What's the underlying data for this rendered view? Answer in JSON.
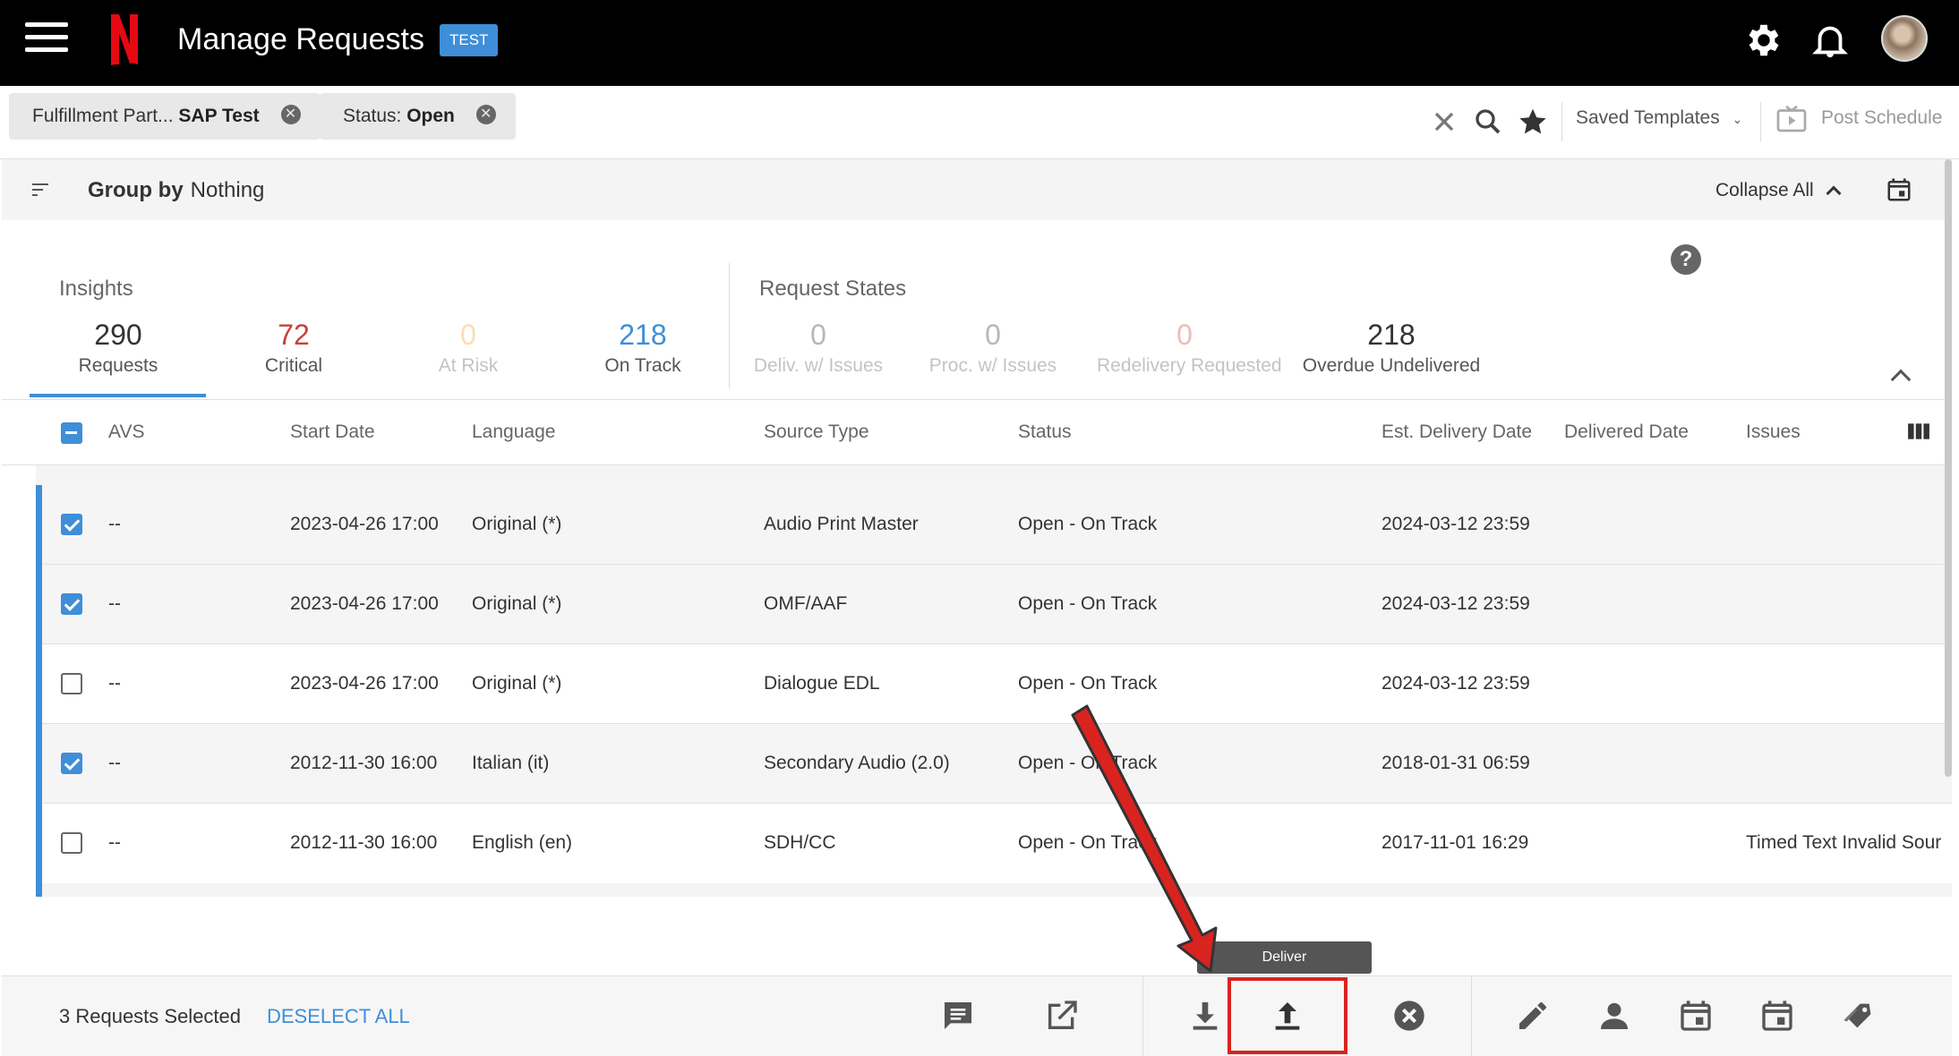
{
  "header": {
    "title": "Manage Requests",
    "env_badge": "TEST",
    "brand_color": "#e50914"
  },
  "filters": {
    "chips": [
      {
        "key": "Fulfillment Part...",
        "value": "SAP Test"
      },
      {
        "key": "Status:",
        "value": "Open"
      }
    ],
    "saved_templates": "Saved Templates",
    "post_schedule": "Post Schedule"
  },
  "group_bar": {
    "label": "Group by",
    "value": "Nothing",
    "collapse_all": "Collapse All"
  },
  "insights": {
    "title": "Insights",
    "metrics": [
      {
        "value": "290",
        "label": "Requests",
        "color": "#333333",
        "faded": false
      },
      {
        "value": "72",
        "label": "Critical",
        "color": "#c9403a",
        "faded": false
      },
      {
        "value": "0",
        "label": "At Risk",
        "color": "#f0a030",
        "faded": true
      },
      {
        "value": "218",
        "label": "On Track",
        "color": "#3f8ed8",
        "faded": false
      }
    ]
  },
  "request_states": {
    "title": "Request States",
    "metrics": [
      {
        "value": "0",
        "label": "Deliv. w/ Issues",
        "color": "#333333",
        "faded": true
      },
      {
        "value": "0",
        "label": "Proc. w/ Issues",
        "color": "#333333",
        "faded": true
      },
      {
        "value": "0",
        "label": "Redelivery Requested",
        "color": "#c9403a",
        "faded": true
      },
      {
        "value": "218",
        "label": "Overdue Undelivered",
        "color": "#333333",
        "faded": false
      }
    ]
  },
  "table": {
    "columns": [
      "AVS",
      "Start Date",
      "Language",
      "Source Type",
      "Status",
      "Est. Delivery Date",
      "Delivered Date",
      "Issues"
    ],
    "rows": [
      {
        "checked": true,
        "avs": "--",
        "start_date": "2023-04-26 17:00",
        "language": "Original (*)",
        "source_type": "Audio Print Master",
        "status": "Open - On Track",
        "est_delivery": "2024-03-12 23:59",
        "delivered": "",
        "issues": ""
      },
      {
        "checked": true,
        "avs": "--",
        "start_date": "2023-04-26 17:00",
        "language": "Original (*)",
        "source_type": "OMF/AAF",
        "status": "Open - On Track",
        "est_delivery": "2024-03-12 23:59",
        "delivered": "",
        "issues": ""
      },
      {
        "checked": false,
        "avs": "--",
        "start_date": "2023-04-26 17:00",
        "language": "Original (*)",
        "source_type": "Dialogue EDL",
        "status": "Open - On Track",
        "est_delivery": "2024-03-12 23:59",
        "delivered": "",
        "issues": ""
      },
      {
        "checked": true,
        "avs": "--",
        "start_date": "2012-11-30 16:00",
        "language": "Italian (it)",
        "source_type": "Secondary Audio (2.0)",
        "status": "Open - On Track",
        "est_delivery": "2018-01-31 06:59",
        "delivered": "",
        "issues": ""
      },
      {
        "checked": false,
        "avs": "--",
        "start_date": "2012-11-30 16:00",
        "language": "English (en)",
        "source_type": "SDH/CC",
        "status": "Open - On Track",
        "est_delivery": "2017-11-01 16:29",
        "delivered": "",
        "issues": "Timed Text Invalid Sour"
      }
    ]
  },
  "action_bar": {
    "selected_text": "3 Requests Selected",
    "deselect_all": "DESELECT ALL",
    "tooltip": "Deliver",
    "icons": [
      "comment-icon",
      "open-external-icon",
      "download-icon",
      "deliver-upload-icon",
      "cancel-icon",
      "edit-icon",
      "assign-user-icon",
      "calendar-icon",
      "calendar-icon",
      "tag-icon"
    ]
  },
  "colors": {
    "accent": "#3f8ed8",
    "annotation_red": "#d9231f"
  }
}
